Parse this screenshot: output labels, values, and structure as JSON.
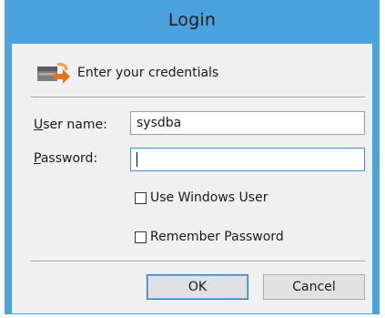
{
  "window": {
    "title": "Login"
  },
  "header": {
    "text": "Enter your credentials",
    "icon": "key-arrow-icon"
  },
  "fields": {
    "username": {
      "label_prefix": "U",
      "label_rest": "ser name:",
      "value": "sysdba"
    },
    "password": {
      "label_prefix": "P",
      "label_rest": "assword:",
      "value": ""
    }
  },
  "options": {
    "use_windows_user": {
      "label": "Use Windows User",
      "checked": false
    },
    "remember_password": {
      "label": "Remember Password",
      "checked": false
    }
  },
  "buttons": {
    "ok": "OK",
    "cancel": "Cancel"
  },
  "colors": {
    "frame": "#4aa3df",
    "client": "#f0f0f0",
    "focus_border": "#3b8fd6"
  }
}
